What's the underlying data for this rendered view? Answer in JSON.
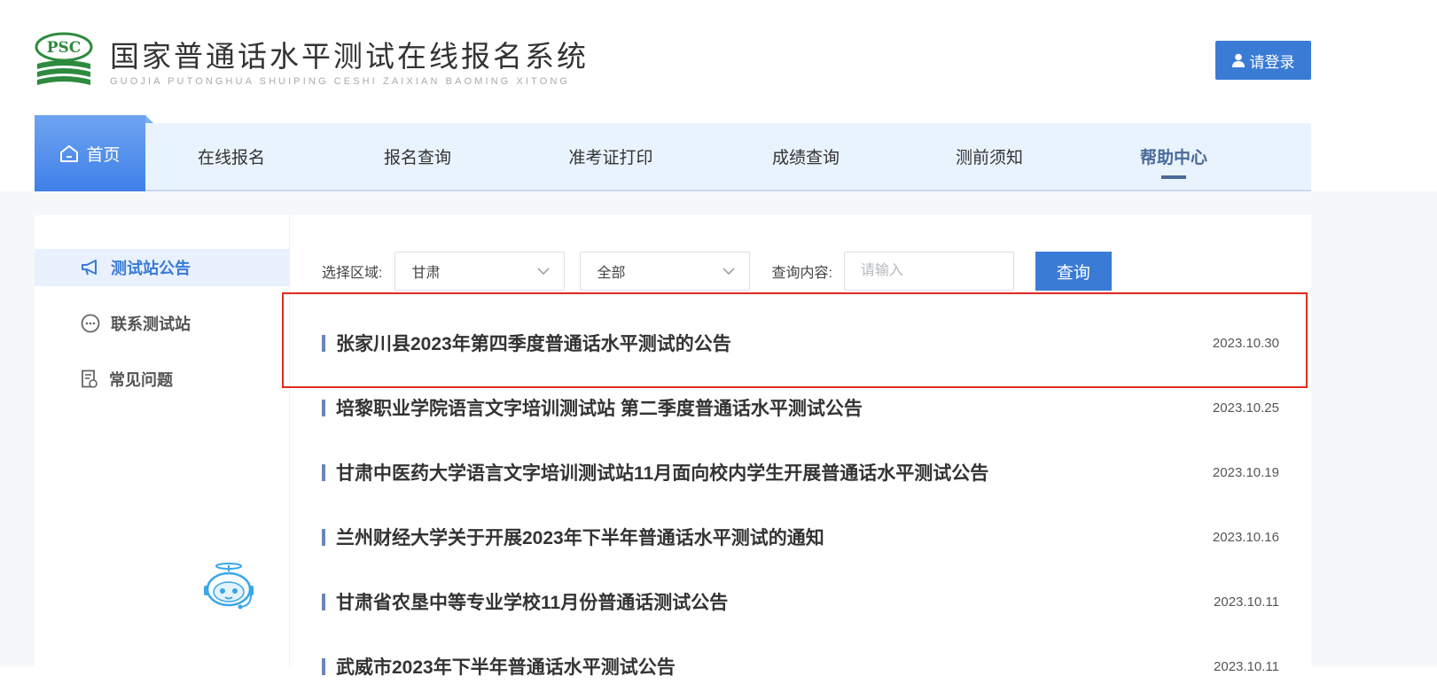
{
  "header": {
    "logo_badge": "PSC",
    "title": "国家普通话水平测试在线报名系统",
    "subtitle": "GUOJIA PUTONGHUA SHUIPING CESHI ZAIXIAN BAOMING XITONG",
    "login_label": "请登录",
    "login_icon": "user-icon"
  },
  "nav": {
    "items": [
      {
        "label": "首页",
        "icon": "home-icon",
        "active": true
      },
      {
        "label": "在线报名"
      },
      {
        "label": "报名查询"
      },
      {
        "label": "准考证打印"
      },
      {
        "label": "成绩查询"
      },
      {
        "label": "测前须知"
      },
      {
        "label": "帮助中心",
        "selected": true
      }
    ]
  },
  "sidebar": {
    "items": [
      {
        "label": "测试站公告",
        "icon": "megaphone-icon",
        "active": true
      },
      {
        "label": "联系测试站",
        "icon": "chat-bubble-icon"
      },
      {
        "label": "常见问题",
        "icon": "document-icon"
      }
    ],
    "assistant_icon": "robot-assistant-icon"
  },
  "filter": {
    "region_label": "选择区域:",
    "province_value": "甘肃",
    "city_value": "全部",
    "query_label": "查询内容:",
    "query_placeholder": "请输入",
    "query_value": "",
    "search_label": "查询"
  },
  "news": [
    {
      "title": "张家川县2023年第四季度普通话水平测试的公告",
      "date": "2023.10.30"
    },
    {
      "title": "培黎职业学院语言文字培训测试站 第二季度普通话水平测试公告",
      "date": "2023.10.25"
    },
    {
      "title": "甘肃中医药大学语言文字培训测试站11月面向校内学生开展普通话水平测试公告",
      "date": "2023.10.19"
    },
    {
      "title": "兰州财经大学关于开展2023年下半年普通话水平测试的通知",
      "date": "2023.10.16"
    },
    {
      "title": "甘肃省农垦中等专业学校11月份普通话测试公告",
      "date": "2023.10.11"
    },
    {
      "title": "武威市2023年下半年普通话水平测试公告",
      "date": "2023.10.11"
    }
  ],
  "colors": {
    "accent": "#3a7bd5",
    "nav_bg": "#e9f3fd",
    "highlight": "#e02a1f",
    "page_bg": "#f6f7f9"
  }
}
